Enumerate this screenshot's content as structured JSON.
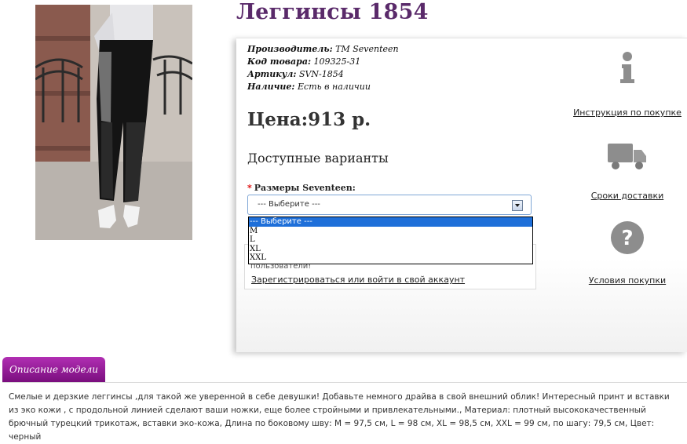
{
  "product": {
    "title": "Леггинсы 1854",
    "manufacturer_label": "Производитель:",
    "manufacturer_value": "ТМ Seventeen",
    "code_label": "Код товара:",
    "code_value": "109325-31",
    "article_label": "Артикул:",
    "article_value": "SVN-1854",
    "availability_label": "Наличие:",
    "availability_value": "Есть в наличии",
    "price": "Цена:913 р.",
    "variants_heading": "Доступные варианты",
    "size_label": "Размеры Seventeen:"
  },
  "size_select": {
    "selected": "--- Выберите ---",
    "options": [
      "--- Выберите ---",
      "M",
      "L",
      "XL",
      "XXL"
    ]
  },
  "notice": {
    "text": "пользователи!",
    "link": "Зарегистрироваться или войти в свой аккаунт"
  },
  "sidebar": {
    "instructions": "Инструкция по покупке",
    "delivery": "Сроки доставки",
    "conditions": "Условия покупки"
  },
  "description": {
    "tab": "Описание модели",
    "text": "Смелые и дерзкие леггинсы ,для такой же уверенной в себе девушки! Добавьте немного драйва в свой внешний облик! Интересный принт и вставки из эко кожи , с продольной линией сделают ваши ножки, еще более стройными и привлекательными., Материал: плотный высококачественный брючный турецкий трикотаж, вставки эко-кожа, Длина по боковому шву: M = 97,5 см, L = 98 см, XL = 98,5 см, XXL = 99 см, по шагу: 79,5 см, Цвет: черный"
  },
  "colors": {
    "title": "#5a2a6a",
    "tab": "#9a1f9d",
    "select_border": "#7ea6d6",
    "highlight": "#1e6fd9"
  },
  "icons": [
    "info-icon",
    "truck-icon",
    "question-icon"
  ]
}
